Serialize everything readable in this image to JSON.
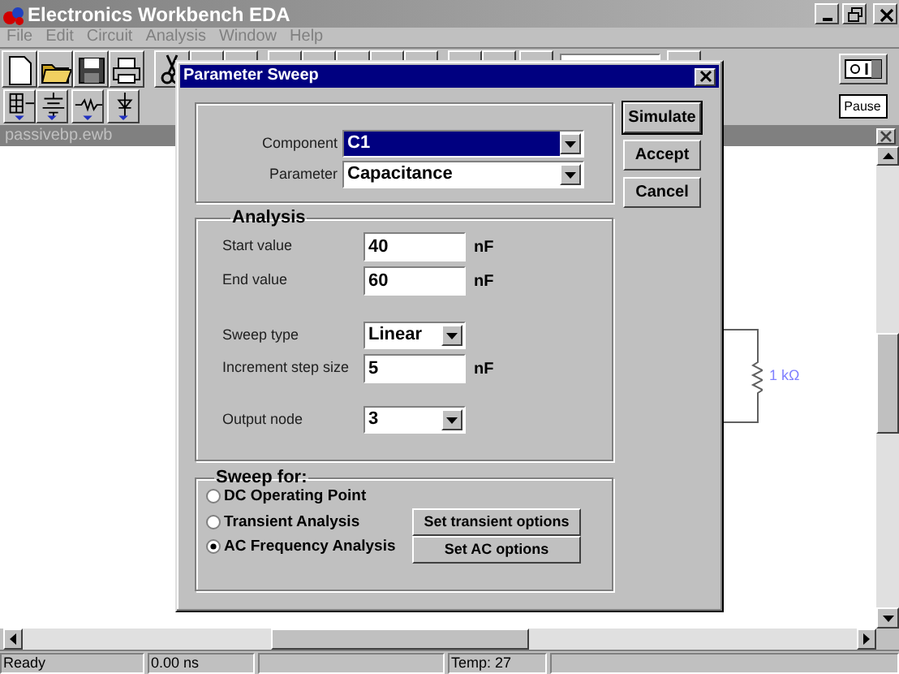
{
  "app_window": {
    "title": "Electronics Workbench EDA"
  },
  "menu": [
    {
      "label": "File"
    },
    {
      "label": "Edit"
    },
    {
      "label": "Circuit"
    },
    {
      "label": "Analysis"
    },
    {
      "label": "Window"
    },
    {
      "label": "Help"
    }
  ],
  "power_switch": {
    "on": false
  },
  "pause_button": {
    "label": "Pause"
  },
  "circuit_window": {
    "title": "passivebp.ewb",
    "resistor_label": "1 kΩ"
  },
  "dialog": {
    "title": "Parameter Sweep",
    "component": {
      "label": "Component",
      "value": "C1"
    },
    "parameter": {
      "label": "Parameter",
      "value": "Capacitance"
    },
    "buttons": [
      {
        "label": "Simulate",
        "default": true
      },
      {
        "label": "Accept",
        "default": false
      },
      {
        "label": "Cancel",
        "default": false
      }
    ],
    "analysis": {
      "title": "Analysis",
      "fields": [
        {
          "kind": "text",
          "label": "Start value",
          "value": "40",
          "unit": "nF"
        },
        {
          "kind": "text",
          "label": "End value",
          "value": "60",
          "unit": "nF"
        },
        {
          "kind": "dropdown",
          "label": "Sweep type",
          "value": "Linear"
        },
        {
          "kind": "text",
          "label": "Increment step size",
          "value": "5",
          "unit": "nF"
        },
        {
          "kind": "dropdown",
          "label": "Output node",
          "value": "3"
        }
      ]
    },
    "sweep_for": {
      "title": "Sweep for:",
      "options": [
        {
          "label": "DC Operating Point",
          "selected": false
        },
        {
          "label": "Transient Analysis",
          "selected": false
        },
        {
          "label": "AC Frequency Analysis",
          "selected": true
        }
      ],
      "buttons": [
        {
          "label": "Set transient options"
        },
        {
          "label": "Set AC options"
        }
      ]
    }
  },
  "status_bar": {
    "message": "Ready",
    "time": "0.00 ns",
    "temperature": "Temp:  27"
  }
}
